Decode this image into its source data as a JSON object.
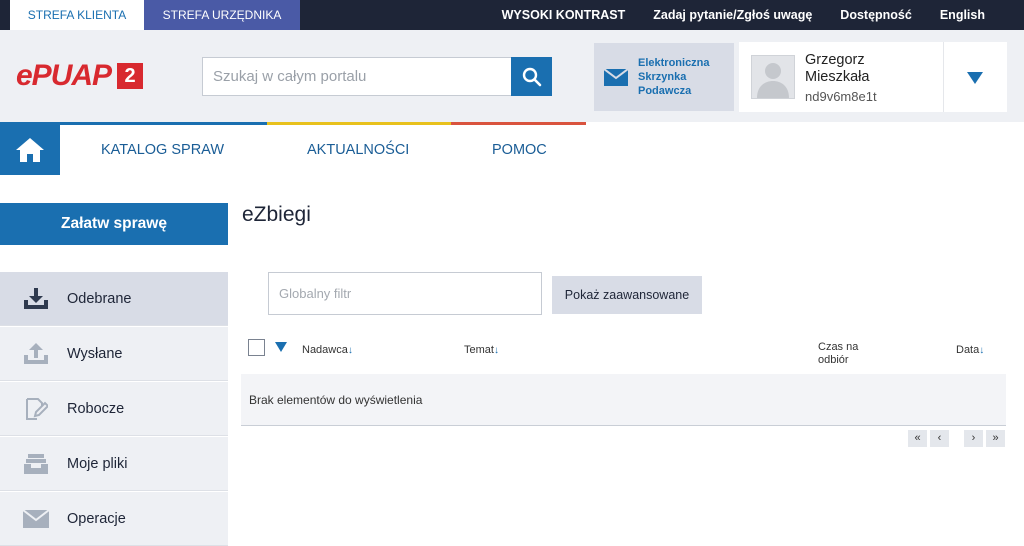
{
  "zones": {
    "client": "STREFA KLIENTA",
    "official": "STREFA URZĘDNIKA"
  },
  "toplinks": [
    "WYSOKI KONTRAST",
    "Zadaj pytanie/Zgłoś uwagę",
    "Dostępność",
    "English"
  ],
  "logo": {
    "text": "ePUAP",
    "badge": "2"
  },
  "search": {
    "placeholder": "Szukaj w całym portalu"
  },
  "inbox": {
    "label": "Elektroniczna Skrzynka Podawcza"
  },
  "user": {
    "name": "Grzegorz Mieszkała",
    "login": "nd9v6m8e1t"
  },
  "colors": {
    "accent": "#1a6fb0",
    "dark": "#1e2537",
    "bar_blue": "#1a6fb0",
    "bar_yellow": "#e8c11c",
    "bar_red": "#d9533e"
  },
  "nav": {
    "items": [
      "KATALOG SPRAW",
      "AKTUALNOŚCI",
      "POMOC"
    ]
  },
  "sidebar": {
    "primary_action": "Załatw sprawę",
    "items": [
      {
        "label": "Odebrane",
        "icon": "inbox-download-icon"
      },
      {
        "label": "Wysłane",
        "icon": "upload-icon"
      },
      {
        "label": "Robocze",
        "icon": "draft-edit-icon"
      },
      {
        "label": "Moje pliki",
        "icon": "files-tray-icon"
      },
      {
        "label": "Operacje",
        "icon": "envelope-icon"
      }
    ]
  },
  "main": {
    "title": "eZbiegi",
    "filter_placeholder": "Globalny filtr",
    "advanced_button": "Pokaż zaawansowane",
    "columns": {
      "sender": "Nadawca",
      "subject": "Temat",
      "time_to_collect": "Czas na odbiór",
      "date": "Data"
    },
    "empty_message": "Brak elementów do wyświetlenia",
    "pager": {
      "first": "«",
      "prev": "‹",
      "next": "›",
      "last": "»"
    }
  }
}
